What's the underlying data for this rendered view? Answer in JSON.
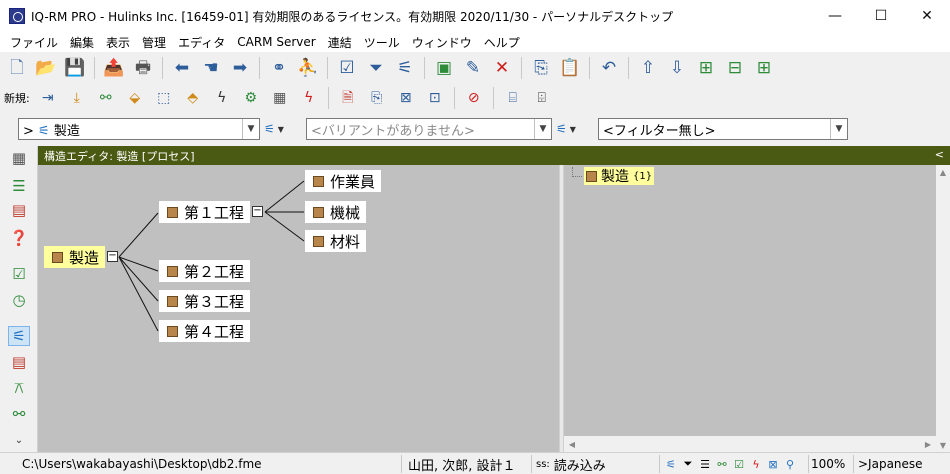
{
  "window": {
    "title": "IQ-RM PRO - Hulinks Inc. [16459-01] 有効期限のあるライセンス。有効期限 2020/11/30 - パーソナルデスクトップ",
    "minimize": "—",
    "maximize": "☐",
    "close": "✕"
  },
  "menu": [
    "ファイル",
    "編集",
    "表示",
    "管理",
    "エディタ",
    "CARM Server",
    "連結",
    "ツール",
    "ウィンドウ",
    "ヘルプ"
  ],
  "toolbar2": {
    "new_label": "新規:"
  },
  "combos": {
    "process": {
      "prefix": ">",
      "value": "製造"
    },
    "variant": {
      "placeholder": "<バリアントがありません>"
    },
    "filter": {
      "value": "<フィルター無し>"
    }
  },
  "editor": {
    "header": "構造エディタ: 製造 [プロセス]",
    "collapse": "<"
  },
  "diagram": {
    "root": "製造",
    "level1": [
      "第１工程",
      "第２工程",
      "第３工程",
      "第４工程"
    ],
    "level2": [
      "作業員",
      "機械",
      "材料"
    ]
  },
  "tree": {
    "item": "製造",
    "count": "{1}"
  },
  "status": {
    "path": "C:\\Users\\wakabayashi\\Desktop\\db2.fme",
    "user": "山田, 次郎, 設計１",
    "mode_prefix": "ss:",
    "mode": "読み込み",
    "zoom": "100%",
    "language": ">Japanese"
  },
  "colors": {
    "header_bg": "#4b5a13",
    "canvas_bg": "#c0c0c0",
    "root_node_bg": "#ffff9e",
    "node_square": "#b8864b"
  }
}
